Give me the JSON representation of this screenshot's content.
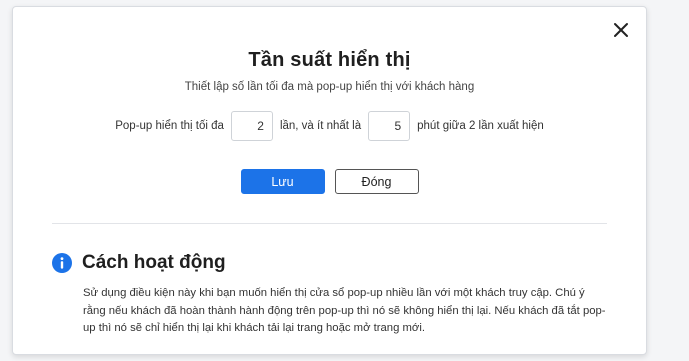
{
  "dialog": {
    "title": "Tần suất hiển thị",
    "subtitle": "Thiết lập số lần tối đa mà pop-up hiển thị với khách hàng",
    "close_icon": "close-icon"
  },
  "frequency": {
    "label_before": "Pop-up hiển thị tối đa",
    "max_times_value": "2",
    "label_middle": "lần, và ít nhất là",
    "min_minutes_value": "5",
    "label_after": "phút giữa 2 lần xuất hiện"
  },
  "actions": {
    "save_label": "Lưu",
    "close_label": "Đóng"
  },
  "how_it_works": {
    "icon": "info-icon",
    "title": "Cách hoạt động",
    "description": "Sử dụng điều kiện này khi bạn muốn hiển thị cửa sổ pop-up nhiều lần với một khách truy cập. Chú ý rằng nếu khách đã hoàn thành hành động trên pop-up thì nó sẽ không hiển thị lại. Nếu khách đã tắt pop-up thì nó sẽ chỉ hiển thị lại khi khách tải lại trang hoặc mở trang mới."
  },
  "colors": {
    "primary": "#1c73e8",
    "info_icon": "#1c73e8",
    "divider": "#e2e4e8"
  }
}
